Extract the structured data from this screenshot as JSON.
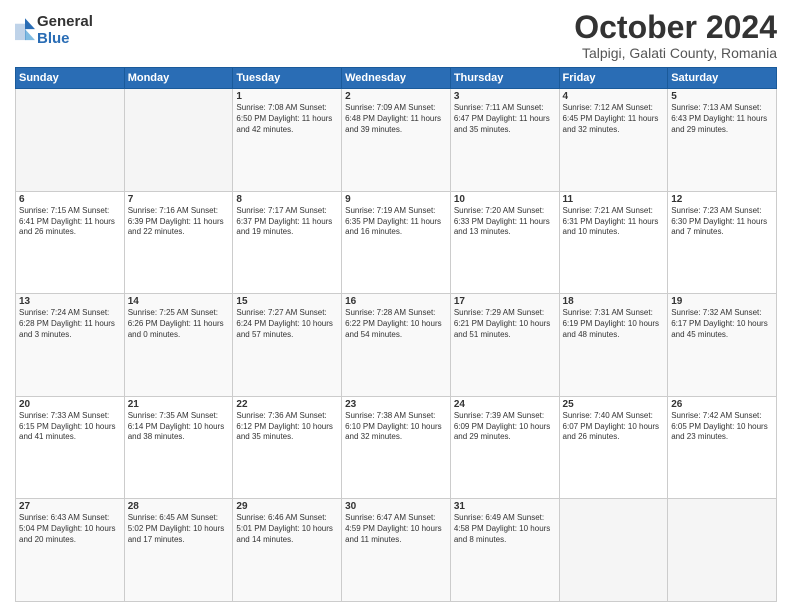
{
  "logo": {
    "general": "General",
    "blue": "Blue"
  },
  "title": "October 2024",
  "location": "Talpigi, Galati County, Romania",
  "days_header": [
    "Sunday",
    "Monday",
    "Tuesday",
    "Wednesday",
    "Thursday",
    "Friday",
    "Saturday"
  ],
  "weeks": [
    [
      {
        "day": "",
        "info": ""
      },
      {
        "day": "",
        "info": ""
      },
      {
        "day": "1",
        "info": "Sunrise: 7:08 AM\nSunset: 6:50 PM\nDaylight: 11 hours and 42 minutes."
      },
      {
        "day": "2",
        "info": "Sunrise: 7:09 AM\nSunset: 6:48 PM\nDaylight: 11 hours and 39 minutes."
      },
      {
        "day": "3",
        "info": "Sunrise: 7:11 AM\nSunset: 6:47 PM\nDaylight: 11 hours and 35 minutes."
      },
      {
        "day": "4",
        "info": "Sunrise: 7:12 AM\nSunset: 6:45 PM\nDaylight: 11 hours and 32 minutes."
      },
      {
        "day": "5",
        "info": "Sunrise: 7:13 AM\nSunset: 6:43 PM\nDaylight: 11 hours and 29 minutes."
      }
    ],
    [
      {
        "day": "6",
        "info": "Sunrise: 7:15 AM\nSunset: 6:41 PM\nDaylight: 11 hours and 26 minutes."
      },
      {
        "day": "7",
        "info": "Sunrise: 7:16 AM\nSunset: 6:39 PM\nDaylight: 11 hours and 22 minutes."
      },
      {
        "day": "8",
        "info": "Sunrise: 7:17 AM\nSunset: 6:37 PM\nDaylight: 11 hours and 19 minutes."
      },
      {
        "day": "9",
        "info": "Sunrise: 7:19 AM\nSunset: 6:35 PM\nDaylight: 11 hours and 16 minutes."
      },
      {
        "day": "10",
        "info": "Sunrise: 7:20 AM\nSunset: 6:33 PM\nDaylight: 11 hours and 13 minutes."
      },
      {
        "day": "11",
        "info": "Sunrise: 7:21 AM\nSunset: 6:31 PM\nDaylight: 11 hours and 10 minutes."
      },
      {
        "day": "12",
        "info": "Sunrise: 7:23 AM\nSunset: 6:30 PM\nDaylight: 11 hours and 7 minutes."
      }
    ],
    [
      {
        "day": "13",
        "info": "Sunrise: 7:24 AM\nSunset: 6:28 PM\nDaylight: 11 hours and 3 minutes."
      },
      {
        "day": "14",
        "info": "Sunrise: 7:25 AM\nSunset: 6:26 PM\nDaylight: 11 hours and 0 minutes."
      },
      {
        "day": "15",
        "info": "Sunrise: 7:27 AM\nSunset: 6:24 PM\nDaylight: 10 hours and 57 minutes."
      },
      {
        "day": "16",
        "info": "Sunrise: 7:28 AM\nSunset: 6:22 PM\nDaylight: 10 hours and 54 minutes."
      },
      {
        "day": "17",
        "info": "Sunrise: 7:29 AM\nSunset: 6:21 PM\nDaylight: 10 hours and 51 minutes."
      },
      {
        "day": "18",
        "info": "Sunrise: 7:31 AM\nSunset: 6:19 PM\nDaylight: 10 hours and 48 minutes."
      },
      {
        "day": "19",
        "info": "Sunrise: 7:32 AM\nSunset: 6:17 PM\nDaylight: 10 hours and 45 minutes."
      }
    ],
    [
      {
        "day": "20",
        "info": "Sunrise: 7:33 AM\nSunset: 6:15 PM\nDaylight: 10 hours and 41 minutes."
      },
      {
        "day": "21",
        "info": "Sunrise: 7:35 AM\nSunset: 6:14 PM\nDaylight: 10 hours and 38 minutes."
      },
      {
        "day": "22",
        "info": "Sunrise: 7:36 AM\nSunset: 6:12 PM\nDaylight: 10 hours and 35 minutes."
      },
      {
        "day": "23",
        "info": "Sunrise: 7:38 AM\nSunset: 6:10 PM\nDaylight: 10 hours and 32 minutes."
      },
      {
        "day": "24",
        "info": "Sunrise: 7:39 AM\nSunset: 6:09 PM\nDaylight: 10 hours and 29 minutes."
      },
      {
        "day": "25",
        "info": "Sunrise: 7:40 AM\nSunset: 6:07 PM\nDaylight: 10 hours and 26 minutes."
      },
      {
        "day": "26",
        "info": "Sunrise: 7:42 AM\nSunset: 6:05 PM\nDaylight: 10 hours and 23 minutes."
      }
    ],
    [
      {
        "day": "27",
        "info": "Sunrise: 6:43 AM\nSunset: 5:04 PM\nDaylight: 10 hours and 20 minutes."
      },
      {
        "day": "28",
        "info": "Sunrise: 6:45 AM\nSunset: 5:02 PM\nDaylight: 10 hours and 17 minutes."
      },
      {
        "day": "29",
        "info": "Sunrise: 6:46 AM\nSunset: 5:01 PM\nDaylight: 10 hours and 14 minutes."
      },
      {
        "day": "30",
        "info": "Sunrise: 6:47 AM\nSunset: 4:59 PM\nDaylight: 10 hours and 11 minutes."
      },
      {
        "day": "31",
        "info": "Sunrise: 6:49 AM\nSunset: 4:58 PM\nDaylight: 10 hours and 8 minutes."
      },
      {
        "day": "",
        "info": ""
      },
      {
        "day": "",
        "info": ""
      }
    ]
  ]
}
